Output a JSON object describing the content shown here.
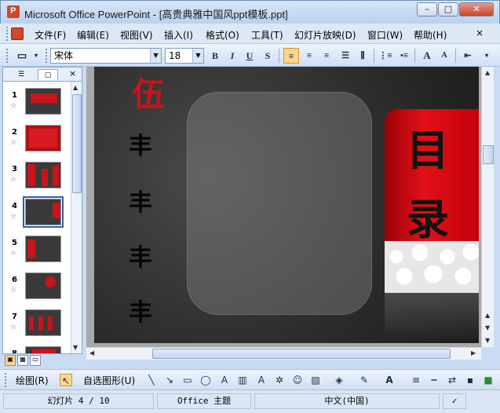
{
  "window": {
    "title": "Microsoft Office PowerPoint - [高贵典雅中国风ppt模板.ppt]",
    "minimize": "–",
    "maximize": "□",
    "close": "✕"
  },
  "menu": {
    "items": [
      "文件(F)",
      "编辑(E)",
      "视图(V)",
      "插入(I)",
      "格式(O)",
      "工具(T)",
      "幻灯片放映(D)",
      "窗口(W)",
      "帮助(H)"
    ],
    "close": "×"
  },
  "toolbar": {
    "font_name": "宋体",
    "font_size": "18",
    "bold": "B",
    "italic": "I",
    "underline": "U",
    "shadow": "S",
    "grow_font": "A",
    "shrink_font": "A"
  },
  "slides_panel": {
    "tab_close": "×",
    "thumbnails": [
      {
        "number": "1",
        "selected": false
      },
      {
        "number": "2",
        "selected": false
      },
      {
        "number": "3",
        "selected": false
      },
      {
        "number": "4",
        "selected": true
      },
      {
        "number": "5",
        "selected": false
      },
      {
        "number": "6",
        "selected": false
      },
      {
        "number": "7",
        "selected": false
      },
      {
        "number": "8",
        "selected": false
      }
    ]
  },
  "slide": {
    "heading_char": "伍",
    "banner_line1": "目",
    "banner_line2": "录",
    "bullet_marks": [
      "丰",
      "丰",
      "丰",
      "丰"
    ]
  },
  "drawing_toolbar": {
    "draw_label": "绘图(R)",
    "autoshapes_label": "自选图形(U)"
  },
  "status": {
    "slide_info": "幻灯片 4 / 10",
    "theme": "Office 主题",
    "language": "中文(中国)"
  },
  "colors": {
    "accent_red": "#c4161c",
    "selection": "#2d5fa6"
  }
}
